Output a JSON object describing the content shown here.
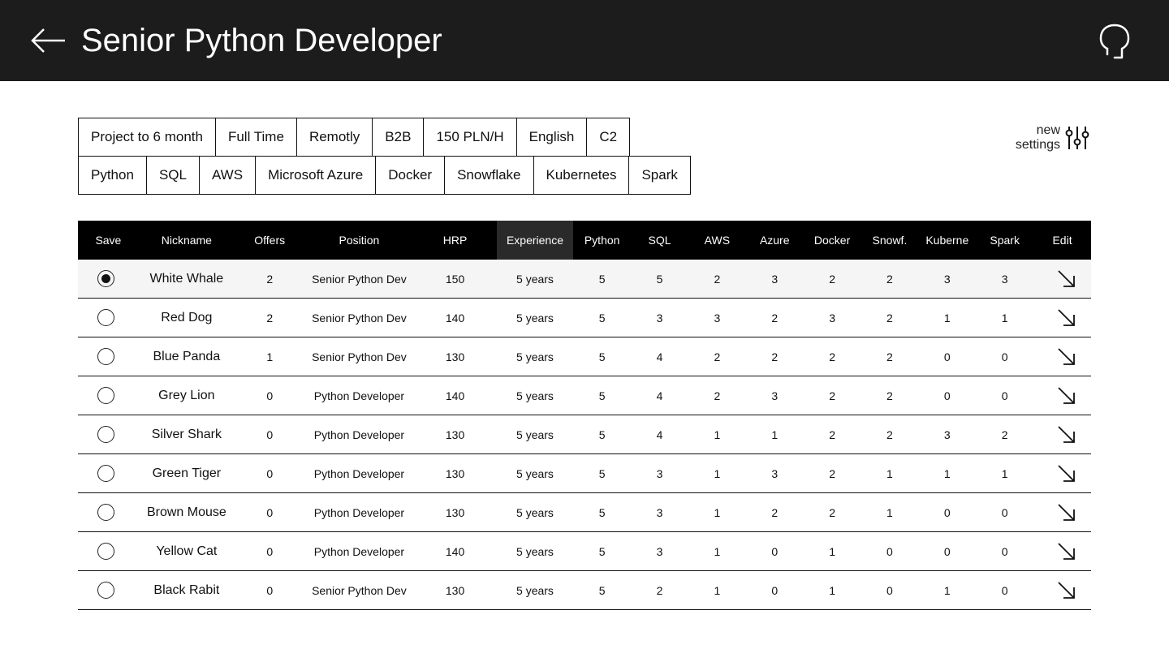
{
  "header": {
    "title": "Senior Python Developer"
  },
  "filters": {
    "row1": [
      "Project to 6 month",
      "Full Time",
      "Remotly",
      "B2B",
      "150 PLN/H",
      "English",
      "C2"
    ],
    "row2": [
      "Python",
      "SQL",
      "AWS",
      "Microsoft Azure",
      "Docker",
      "Snowflake",
      "Kubernetes",
      "Spark"
    ]
  },
  "settings": {
    "line1": "new",
    "line2": "settings"
  },
  "table": {
    "columns": [
      "Save",
      "Nickname",
      "Offers",
      "Position",
      "HRP",
      "Experience",
      "Python",
      "SQL",
      "AWS",
      "Azure",
      "Docker",
      "Snowf.",
      "Kuberne",
      "Spark",
      "Edit"
    ],
    "sorted_column": "Experience",
    "rows": [
      {
        "selected": true,
        "nickname": "White Whale",
        "offers": "2",
        "position": "Senior Python Dev",
        "hrp": "150",
        "experience": "5 years",
        "python": "5",
        "sql": "5",
        "aws": "2",
        "azure": "3",
        "docker": "2",
        "snowflake": "2",
        "kubernetes": "3",
        "spark": "3"
      },
      {
        "selected": false,
        "nickname": "Red Dog",
        "offers": "2",
        "position": "Senior Python Dev",
        "hrp": "140",
        "experience": "5 years",
        "python": "5",
        "sql": "3",
        "aws": "3",
        "azure": "2",
        "docker": "3",
        "snowflake": "2",
        "kubernetes": "1",
        "spark": "1"
      },
      {
        "selected": false,
        "nickname": "Blue Panda",
        "offers": "1",
        "position": "Senior Python Dev",
        "hrp": "130",
        "experience": "5 years",
        "python": "5",
        "sql": "4",
        "aws": "2",
        "azure": "2",
        "docker": "2",
        "snowflake": "2",
        "kubernetes": "0",
        "spark": "0"
      },
      {
        "selected": false,
        "nickname": "Grey Lion",
        "offers": "0",
        "position": "Python Developer",
        "hrp": "140",
        "experience": "5 years",
        "python": "5",
        "sql": "4",
        "aws": "2",
        "azure": "3",
        "docker": "2",
        "snowflake": "2",
        "kubernetes": "0",
        "spark": "0"
      },
      {
        "selected": false,
        "nickname": "Silver Shark",
        "offers": "0",
        "position": "Python Developer",
        "hrp": "130",
        "experience": "5 years",
        "python": "5",
        "sql": "4",
        "aws": "1",
        "azure": "1",
        "docker": "2",
        "snowflake": "2",
        "kubernetes": "3",
        "spark": "2"
      },
      {
        "selected": false,
        "nickname": "Green Tiger",
        "offers": "0",
        "position": "Python Developer",
        "hrp": "130",
        "experience": "5 years",
        "python": "5",
        "sql": "3",
        "aws": "1",
        "azure": "3",
        "docker": "2",
        "snowflake": "1",
        "kubernetes": "1",
        "spark": "1"
      },
      {
        "selected": false,
        "nickname": "Brown Mouse",
        "offers": "0",
        "position": "Python Developer",
        "hrp": "130",
        "experience": "5 years",
        "python": "5",
        "sql": "3",
        "aws": "1",
        "azure": "2",
        "docker": "2",
        "snowflake": "1",
        "kubernetes": "0",
        "spark": "0"
      },
      {
        "selected": false,
        "nickname": "Yellow Cat",
        "offers": "0",
        "position": "Python Developer",
        "hrp": "140",
        "experience": "5 years",
        "python": "5",
        "sql": "3",
        "aws": "1",
        "azure": "0",
        "docker": "1",
        "snowflake": "0",
        "kubernetes": "0",
        "spark": "0"
      },
      {
        "selected": false,
        "nickname": "Black Rabit",
        "offers": "0",
        "position": "Senior Python Dev",
        "hrp": "130",
        "experience": "5 years",
        "python": "5",
        "sql": "2",
        "aws": "1",
        "azure": "0",
        "docker": "1",
        "snowflake": "0",
        "kubernetes": "1",
        "spark": "0"
      }
    ]
  },
  "icons": {
    "back": "arrow-left-icon",
    "profile": "user-profile-icon",
    "settings": "sliders-icon",
    "edit": "arrow-down-right-icon",
    "save": "radio-icon"
  },
  "colors": {
    "header_bg": "#1c1c1c",
    "table_header_bg": "#000000",
    "sorted_header_bg": "#2a2a2a",
    "active_row_bg": "#f5f5f5"
  }
}
